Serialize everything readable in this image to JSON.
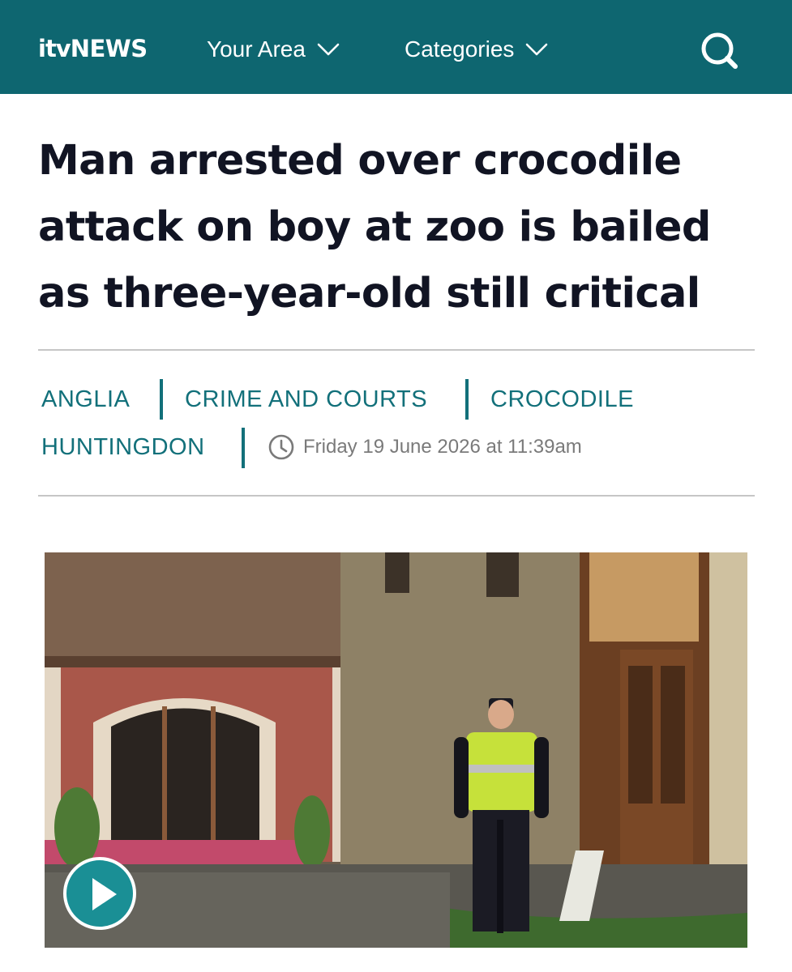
{
  "header": {
    "logo_itv": "itv",
    "logo_news": "NEWS",
    "nav": [
      {
        "label": "Your Area"
      },
      {
        "label": "Categories"
      }
    ],
    "search_icon": "search-icon"
  },
  "article": {
    "headline": "Man arrested over crocodile attack on boy at zoo is bailed as three-year-old still critical",
    "tags": [
      "ANGLIA",
      "CRIME AND COURTS",
      "CROCODILE",
      "HUNTINGDON"
    ],
    "timestamp": "Friday 19 June 2026 at 11:39am"
  },
  "media": {
    "play_icon": "play-icon"
  },
  "colors": {
    "brand": "#0e6670",
    "tag": "#12707a",
    "play": "#1a8f95"
  }
}
